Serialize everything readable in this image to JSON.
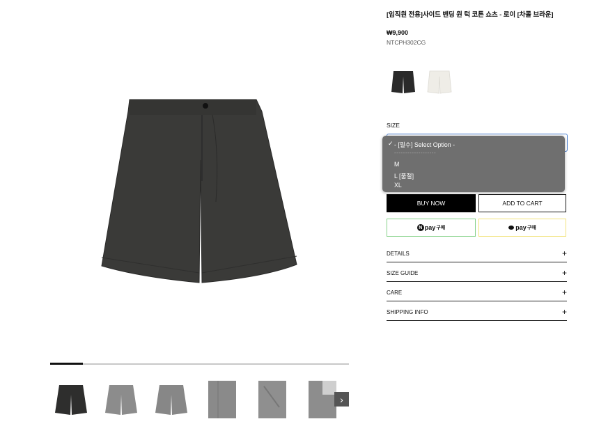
{
  "product": {
    "title": "[임직원 전용]사이드 밴딩 원 턱 코튼 쇼츠 - 로이 [차콜 브라운]",
    "price": "₩9,900",
    "sku": "NTCPH302CG",
    "gallery_progress": 0.11
  },
  "thumbnails": [
    {
      "name": "charcoal shorts front"
    },
    {
      "name": "grey shorts front"
    },
    {
      "name": "grey shorts back"
    },
    {
      "name": "fabric detail 1"
    },
    {
      "name": "fabric detail 2"
    },
    {
      "name": "fabric detail 3"
    }
  ],
  "thumb_next_icon": "›",
  "color_swatches": [
    {
      "name": "charcoal",
      "color": "#2a2a2a"
    },
    {
      "name": "ivory",
      "color": "#efede7"
    }
  ],
  "size": {
    "label": "SIZE",
    "selected": "- [필수] Select Option -",
    "separator": "-------------------",
    "options": [
      "M",
      "L [품절]",
      "XL"
    ],
    "qty_fragment": ")"
  },
  "actions": {
    "buy_now": "BUY NOW",
    "add_to_cart": "ADD TO CART"
  },
  "payments": {
    "naver_logo": "N",
    "naver_text": "pay",
    "naver_sub": "구매",
    "kakao_text": "pay",
    "kakao_sub": "구매"
  },
  "accordion": [
    {
      "label": "DETAILS",
      "icon": "+"
    },
    {
      "label": "SIZE GUIDE",
      "icon": "+"
    },
    {
      "label": "CARE",
      "icon": "+"
    },
    {
      "label": "SHIPPING INFO",
      "icon": "+"
    }
  ],
  "colors": {
    "shorts_dark": "#3a3a38",
    "shorts_grey": "#8c8c8c",
    "dropdown_bg": "#6f6f6f"
  }
}
